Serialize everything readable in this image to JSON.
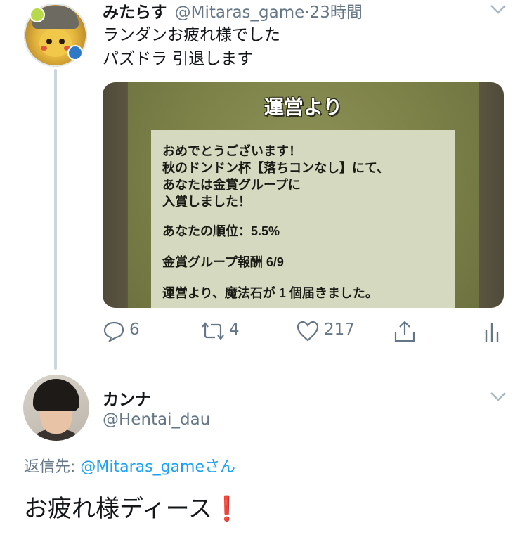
{
  "tweet": {
    "author_name": "みたらす",
    "author_handle": "@Mitaras_game",
    "separator": "·",
    "time": "23時間",
    "lines": [
      "ランダンお疲れ様でした",
      "パズドラ 引退します"
    ],
    "media": {
      "title": "運営より",
      "message_lines": [
        "おめでとうございます！",
        "秋のドンドン杯【落ちコンなし】にて、",
        "あなたは金賞グループに",
        "入賞しました！",
        "あなたの順位：5.5%",
        "金賞グループ報酬 6/9",
        "運営より、魔法石が 1 個届きました。"
      ]
    },
    "actions": {
      "replies": "6",
      "retweets": "4",
      "likes": "217"
    }
  },
  "reply": {
    "author_name": "カンナ",
    "author_handle": "@Hentai_dau",
    "reply_to_prefix": "返信先: ",
    "reply_to_handle": "@Mitaras_game",
    "reply_to_suffix": "さん",
    "text": "お疲れ様ディース",
    "emoji": "❗"
  },
  "colors": {
    "accent": "#1da1f2",
    "muted": "#657786",
    "thread_line": "#ccd6dd"
  }
}
